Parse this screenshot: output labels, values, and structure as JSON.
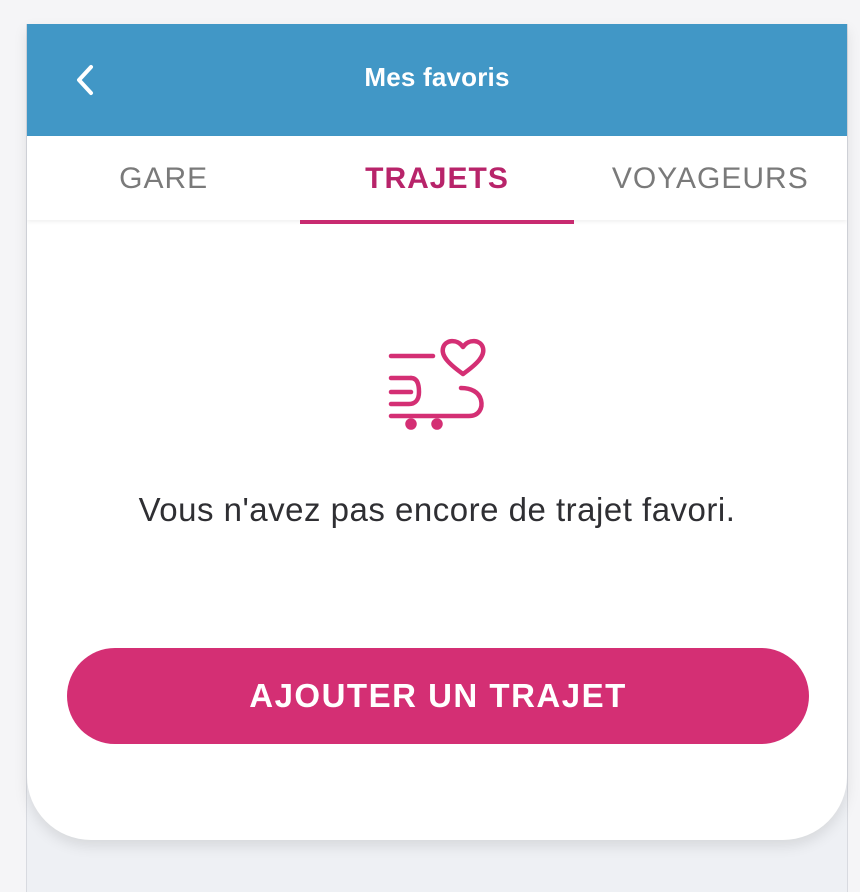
{
  "header": {
    "title": "Mes favoris",
    "back_icon": "chevron-left-icon"
  },
  "tabs": [
    {
      "label": "GARE",
      "active": false
    },
    {
      "label": "TRAJETS",
      "active": true
    },
    {
      "label": "VOYAGEURS",
      "active": false
    }
  ],
  "empty_state": {
    "icon": "train-heart-icon",
    "message": "Vous n'avez pas encore de trajet favori."
  },
  "action": {
    "add_label": "AJOUTER UN TRAJET"
  },
  "colors": {
    "header_blue": "#4197c6",
    "accent_pink": "#d42f74",
    "active_tab": "#b8246a"
  }
}
